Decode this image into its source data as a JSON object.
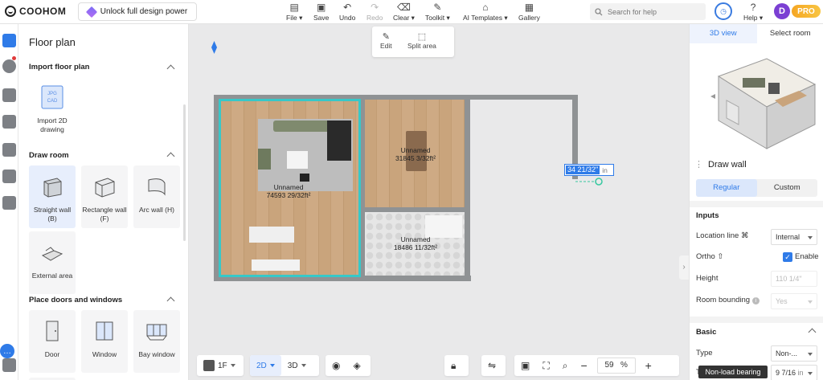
{
  "app": {
    "logo": "COOHOM",
    "unlock_label": "Unlock full design power"
  },
  "toolbar": [
    {
      "label": "File",
      "icon": "file-icon",
      "caret": true,
      "disabled": false
    },
    {
      "label": "Save",
      "icon": "save-icon",
      "caret": false,
      "disabled": false
    },
    {
      "label": "Undo",
      "icon": "undo-icon",
      "caret": false,
      "disabled": false
    },
    {
      "label": "Redo",
      "icon": "redo-icon",
      "caret": false,
      "disabled": true
    },
    {
      "label": "Clear",
      "icon": "clear-icon",
      "caret": true,
      "disabled": false
    },
    {
      "label": "Toolkit",
      "icon": "toolkit-icon",
      "caret": true,
      "disabled": false
    },
    {
      "label": "AI Templates",
      "icon": "ai-templates-icon",
      "caret": true,
      "disabled": false
    },
    {
      "label": "Gallery",
      "icon": "gallery-icon",
      "caret": false,
      "disabled": false
    }
  ],
  "search": {
    "placeholder": "Search for help"
  },
  "user": {
    "help_label": "Help",
    "avatar_initial": "D",
    "badge": "PRO"
  },
  "left_panel": {
    "title": "Floor plan",
    "import_section": {
      "header": "Import floor plan",
      "card_label": "Import 2D drawing",
      "file_types": [
        "JPG",
        "CAD"
      ]
    },
    "draw_room": {
      "header": "Draw room",
      "items": [
        {
          "label": "Straight wall (B)",
          "selected": true
        },
        {
          "label": "Rectangle wall (F)",
          "selected": false
        },
        {
          "label": "Arc wall (H)",
          "selected": false
        },
        {
          "label": "External area",
          "selected": false
        }
      ]
    },
    "doors_windows": {
      "header": "Place doors and windows",
      "items": [
        {
          "label": "Door"
        },
        {
          "label": "Window"
        },
        {
          "label": "Bay window"
        }
      ]
    }
  },
  "canvas": {
    "edit_popup": {
      "edit_label": "Edit",
      "split_label": "Split area"
    },
    "rooms": [
      {
        "name": "Unnamed",
        "area": "74593 29/32ft²"
      },
      {
        "name": "Unnamed",
        "area": "31845 3/32ft²"
      },
      {
        "name": "Unnamed",
        "area": "18486 11/32ft²"
      }
    ],
    "measure": {
      "value": "34 21/32\"",
      "unit": "in"
    }
  },
  "bottom_bar": {
    "floor": "1F",
    "view_2d": "2D",
    "view_3d": "3D",
    "zoom_value": "59",
    "zoom_unit": "%"
  },
  "right_panel": {
    "tabs": [
      {
        "label": "3D view",
        "active": true
      },
      {
        "label": "Select room",
        "active": false
      }
    ],
    "draw_wall_title": "Draw wall",
    "modes": [
      {
        "label": "Regular",
        "active": true
      },
      {
        "label": "Custom",
        "active": false
      }
    ],
    "inputs_header": "Inputs",
    "location_line": {
      "label": "Location line",
      "value": "Internal"
    },
    "ortho": {
      "label": "Ortho",
      "option_label": "Enable",
      "checked": true
    },
    "height": {
      "label": "Height",
      "value": "110 1/4\""
    },
    "room_bounding": {
      "label": "Room bounding",
      "value": "Yes"
    },
    "basic_header": "Basic",
    "type": {
      "label": "Type",
      "value": "Non-..."
    },
    "thickness": {
      "label": "T",
      "value": "9 7/16",
      "unit": "in"
    },
    "tooltip": "Non-load bearing"
  },
  "colors": {
    "accent": "#2f7be8",
    "room_selection": "#37c8c8",
    "pro_badge": "#f5a623"
  }
}
